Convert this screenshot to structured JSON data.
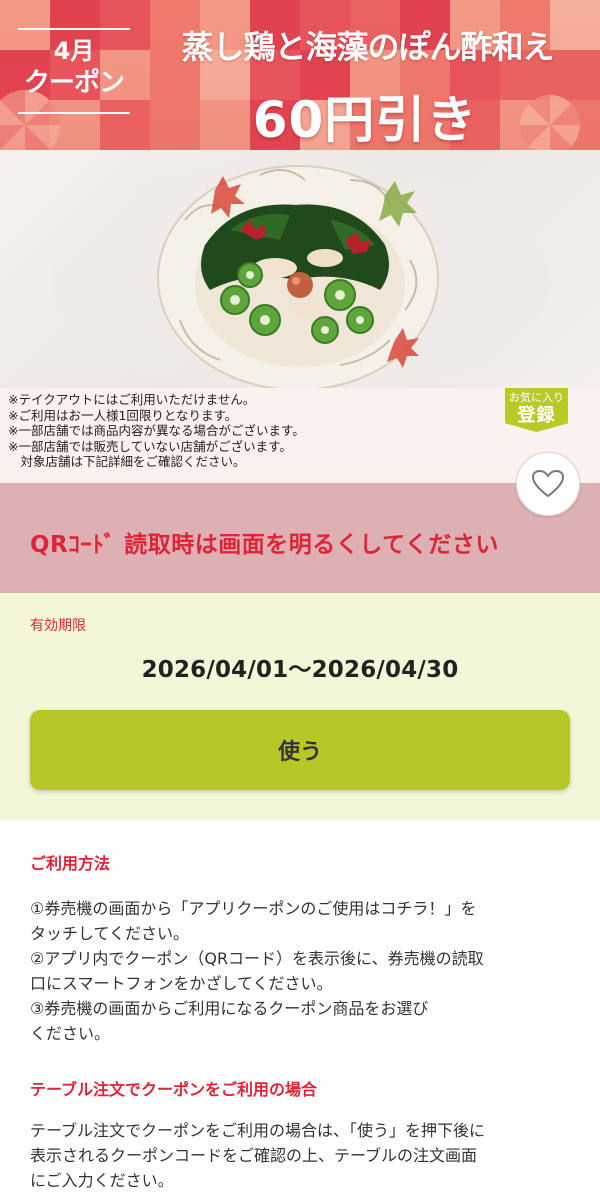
{
  "banner": {
    "month_line1": "4月",
    "month_line2": "クーポン",
    "product_title": "蒸し鶏と海藻のぽん酢和え",
    "discount": "60円引き"
  },
  "photo": {
    "subject": "Steamed chicken with seaweed and okra in ponzu, served in a decorative porcelain bowl",
    "bowl_color": "#f5efe6",
    "seaweed_color": "#1f4a1c",
    "okra_color": "#5ea63c"
  },
  "notes": {
    "items": [
      "※テイクアウトにはご利用いただけません。",
      "※ご利用はお一人様1回限りとなります。",
      "※一部店舗では商品内容が異なる場合がございます。",
      "※一部店舗では販売していない店舗がございます。",
      "　対象店舗は下記詳細をご確認ください。"
    ]
  },
  "favorite": {
    "line1": "お気に入り",
    "line2": "登録",
    "icon": "heart-icon"
  },
  "qr_notice": "QRｺｰﾄﾞ 読取時は画面を明るくしてください",
  "validity": {
    "label": "有効期限",
    "range": "2026/04/01～2026/04/30"
  },
  "use_button": "使う",
  "usage": {
    "heading": "ご利用方法",
    "steps": [
      "①券売機の画面から「アプリクーポンのご使用はコチラ！」を",
      "タッチしてください。",
      "②アプリ内でクーポン（QRコード）を表示後に、券売機の読取",
      "口にスマートフォンをかざしてください。",
      "③券売機の画面からご利用になるクーポン商品をお選び",
      "ください。"
    ]
  },
  "table_order": {
    "heading": "テーブル注文でクーポンをご利用の場合",
    "lines": [
      "テーブル注文でクーポンをご利用の場合は、「使う」を押下後に",
      "表示されるクーポンコードをご確認の上、テーブルの注文画面",
      "にご入力ください。"
    ]
  },
  "colors": {
    "accent_red": "#e02438",
    "banner_red": "#e8545c",
    "qr_band": "#ddb1b4",
    "validity_bg": "#f3f7d8",
    "button_green": "#b7c826"
  }
}
